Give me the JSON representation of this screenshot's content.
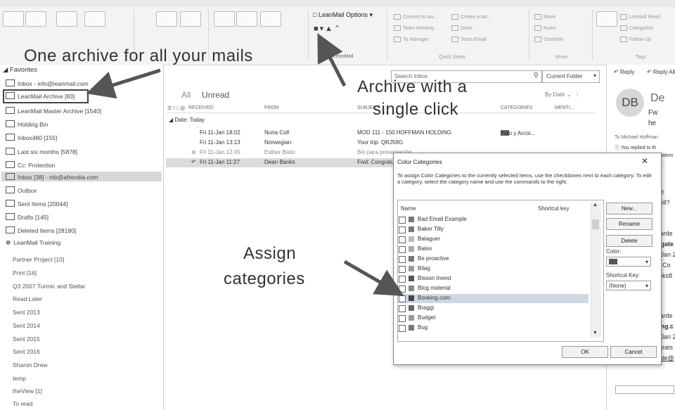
{
  "ribbon": {
    "leanmail_options": "LeanMail Options",
    "leanmail_group": "LeanMail",
    "quick_steps_group": "Quick Steps",
    "move_group": "Move",
    "tags_group": "Tags"
  },
  "captions": {
    "archive_all": "One archive for all your mails",
    "archive_click_1": "Archive with a",
    "archive_click_2": "single click",
    "assign_1": "Assign",
    "assign_2": "categories"
  },
  "folders": {
    "favorites": "Favorites",
    "items": [
      "Inbox - info@leanmail.com",
      "LeanMail Archive [83]",
      "LeanMail Master Archive [1540]",
      "Holding Bin",
      "Inbox480 [155]",
      "Last six months [5878]",
      "Cc: Protection",
      "Inbox [38] - mb@afrendia.com",
      "Outbox",
      "Sent Items [20044]",
      "Drafts [145]",
      "Deleted Items [28180]",
      "LeanMail Training"
    ],
    "subitems": [
      "Partner Project [10]",
      "Print [16]",
      "Q3 2007 Turmic and Stellar",
      "Read Later",
      "Sent 2013",
      "Sent 2014",
      "Sent 2015",
      "Sent 2016",
      "Sharon Drew",
      "temp",
      "theView [1]",
      "To read"
    ]
  },
  "messages": {
    "search_placeholder": "Search Inbox",
    "current_folder": "Current Folder",
    "tab_all": "All",
    "tab_unread": "Unread",
    "sort": "By Date",
    "columns": [
      "RECEIVED",
      "FROM",
      "SUBJECT",
      "CATEGORIES",
      "MENTI..."
    ],
    "group": "Date: Today",
    "rows": [
      {
        "received": "Fri 11-Jan 18:02",
        "from": "Nuria Coll",
        "subject": "MOD 111 - 150 HOFFMAN HOLDING",
        "category": "Polo y Arcoi..."
      },
      {
        "received": "Fri 11-Jan 13:13",
        "from": "Norwegian",
        "subject": "Your trip: QRJ59G",
        "category": ""
      },
      {
        "received": "Fri 11-Jan 12:45",
        "from": "Esther Bieto",
        "subject": "Bio para presentación",
        "category": ""
      },
      {
        "received": "Fri 11-Jan 11:27",
        "from": "Dean Banks",
        "subject": "Fwd: Congratulations",
        "category": ""
      }
    ]
  },
  "reading": {
    "reply": "Reply",
    "reply_all": "Reply All",
    "initials": "DB",
    "to": "To  Michael Hoffman",
    "replied": "You replied to th",
    "lines": [
      "Fw",
      "he",
      "problem",
      "ser.",
      "est",
      "well?",
      "warde",
      "elgate",
      "1 Jan 2",
      "d: Co",
      "anks8",
      "warde",
      "king.c",
      "1 Jan 2",
      "ngrats",
      "gate@"
    ]
  },
  "dialog": {
    "title": "Color Categories",
    "description": "To assign Color Categories to the currently selected items, use the checkboxes next to each category. To edit a category, select the category name and use the commands to the right.",
    "col_name": "Name",
    "col_shortcut": "Shortcut key",
    "categories": [
      "Bad Email Example",
      "Baker Tilly",
      "Balaguer",
      "Batex",
      "Be proactive",
      "Bilag",
      "Bisson Invest",
      "Blog material",
      "Booking.com",
      "Braggi",
      "Budget",
      "Bug"
    ],
    "selected_index": 8,
    "buttons": {
      "new": "New...",
      "rename": "Rename",
      "delete": "Delete",
      "ok": "OK",
      "cancel": "Cancel"
    },
    "color_label": "Color:",
    "shortcut_label": "Shortcut Key:",
    "shortcut_value": "(None)"
  }
}
